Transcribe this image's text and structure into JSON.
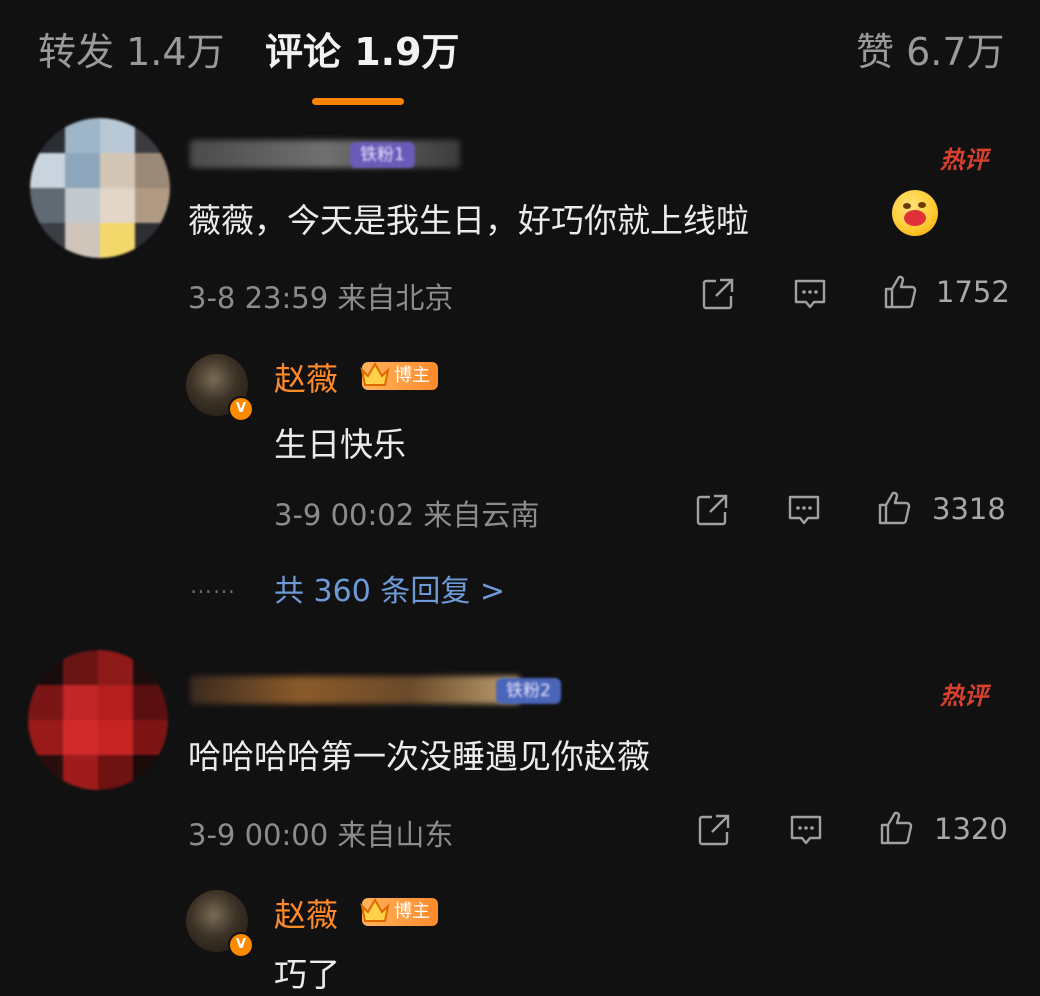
{
  "tabs": [
    {
      "label": "转发 1.4万"
    },
    {
      "label": "评论 1.9万"
    },
    {
      "label": "赞 6.7万"
    }
  ],
  "hot_label": "热评",
  "fan_badges": [
    "铁粉1",
    "铁粉2"
  ],
  "blogger_badge": "博主",
  "verified_mark": "V",
  "comments": [
    {
      "text": "薇薇，今天是我生日，好巧你就上线啦",
      "time": "3-8 23:59 来自北京",
      "likes": "1752",
      "reply": {
        "author": "赵薇",
        "text": "生日快乐",
        "time": "3-9 00:02 来自云南",
        "likes": "3318"
      },
      "more_dots": "……",
      "more_replies": "共 360 条回复 >"
    },
    {
      "text": "哈哈哈哈第一次没睡遇见你赵薇",
      "time": "3-9 00:00 来自山东",
      "likes": "1320",
      "reply": {
        "author": "赵薇",
        "text": "巧了"
      }
    }
  ],
  "colors": {
    "background": "#111112",
    "accent": "#ff8200",
    "hot": "#d8402f",
    "link": "#6e9ad8",
    "author": "#ff8a2b"
  },
  "icons": [
    "share-icon",
    "comment-icon",
    "like-icon",
    "crown-icon",
    "emoji-icon"
  ]
}
